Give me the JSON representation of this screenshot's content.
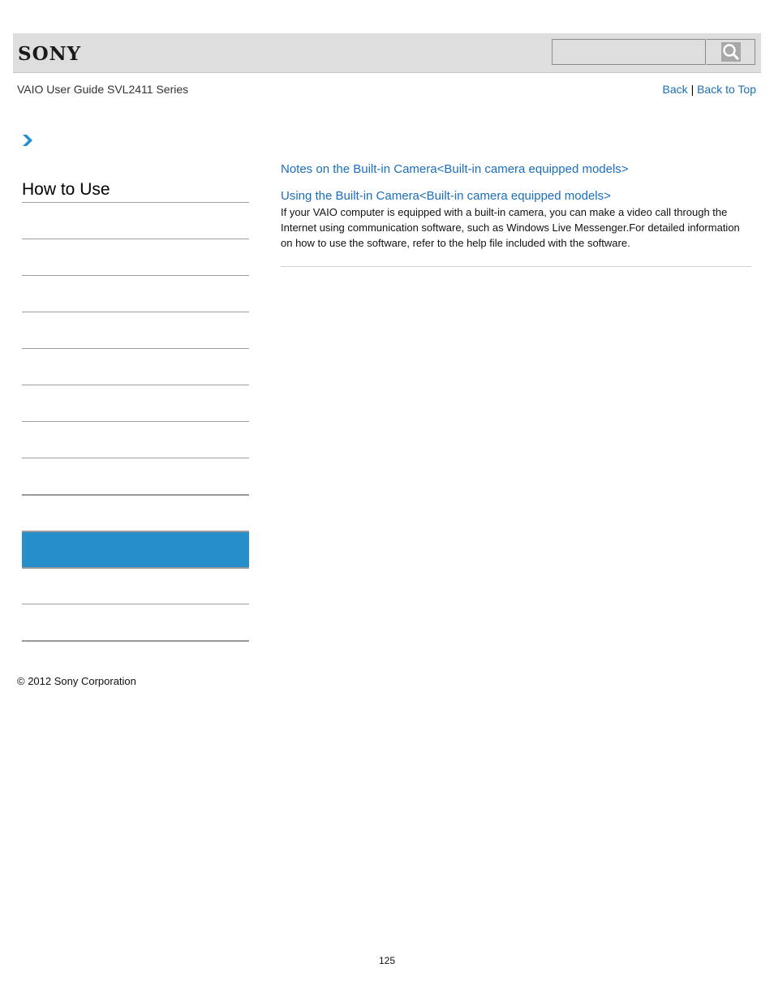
{
  "header": {
    "brand": "SONY",
    "search": {
      "placeholder": "",
      "value": "",
      "button_icon": "search-icon"
    }
  },
  "guide_title": "VAIO User Guide SVL2411 Series",
  "top_links": {
    "back": "Back",
    "separator": "|",
    "back_to_top": "Back to Top"
  },
  "breadcrumb": {
    "icon": "chevron-right-icon",
    "color": "#268ecb"
  },
  "sidebar": {
    "title": "How to Use",
    "items": [
      {
        "label": "",
        "active": false
      },
      {
        "label": "",
        "active": false
      },
      {
        "label": "",
        "active": false
      },
      {
        "label": "",
        "active": false
      },
      {
        "label": "",
        "active": false
      },
      {
        "label": "",
        "active": false
      },
      {
        "label": "",
        "active": false
      },
      {
        "label": "",
        "active": false
      },
      {
        "label": "",
        "active": false
      },
      {
        "label": "",
        "active": true
      },
      {
        "label": "",
        "active": false
      },
      {
        "label": "",
        "active": false
      }
    ],
    "active_color": "#268ecb"
  },
  "main": {
    "links": [
      "Notes on the Built-in Camera<Built-in camera equipped models>",
      "Using the Built-in Camera<Built-in camera equipped models>"
    ],
    "description": "If your VAIO computer is equipped with a built-in camera, you can make a video call through the Internet using communication software, such as Windows Live Messenger.For detailed information on how to use the software, refer to the help file included with the software."
  },
  "footer": {
    "copyright": "© 2012 Sony Corporation",
    "page_number": "125"
  }
}
